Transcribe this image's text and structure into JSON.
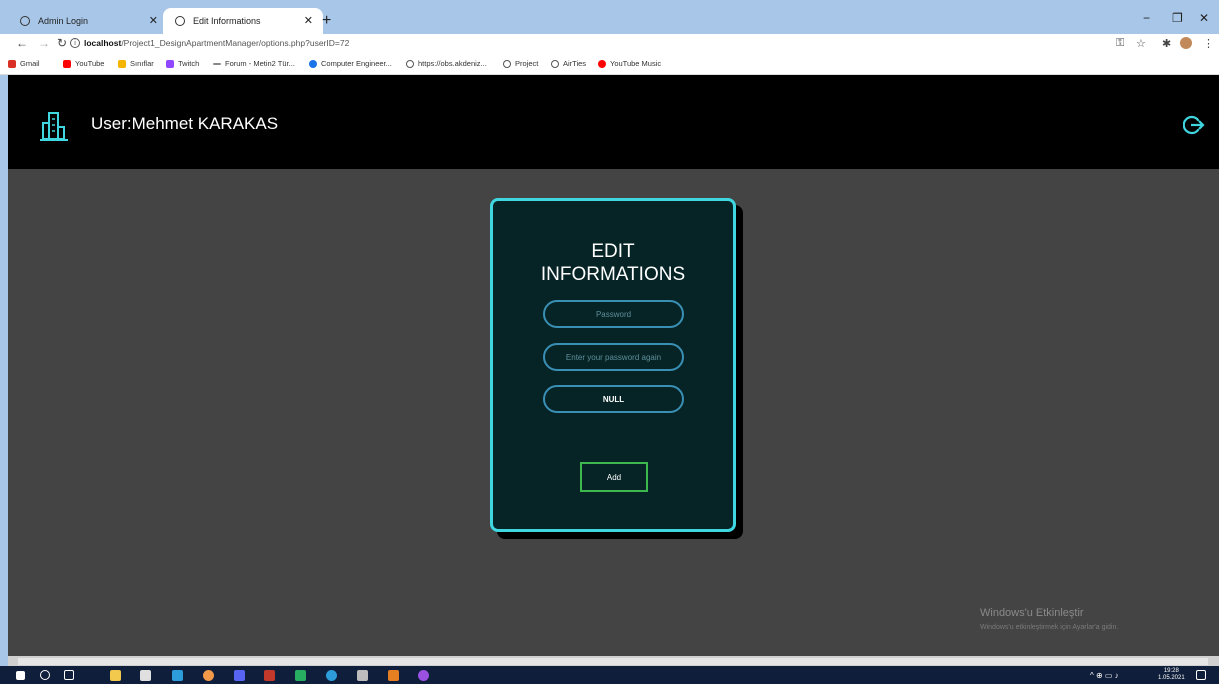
{
  "browser": {
    "tabs": [
      {
        "label": "Admin Login"
      },
      {
        "label": "Edit Informations"
      }
    ],
    "new_tab": "+",
    "url_host": "localhost",
    "url_path": "/Project1_DesignApartmentManager/options.php?userID=72",
    "window_controls": {
      "minimize": "−",
      "restore": "❐",
      "close": "✕"
    },
    "bookmarks": [
      {
        "label": "Gmail",
        "color": "#d93025"
      },
      {
        "label": "YouTube",
        "color": "#ff0000"
      },
      {
        "label": "Sınıflar",
        "color": "#f4b400"
      },
      {
        "label": "Twitch",
        "color": "#9146ff"
      },
      {
        "label": "Forum - Metin2 Tür...",
        "color": "#888888"
      },
      {
        "label": "Computer Engineer...",
        "color": "#1a73e8"
      },
      {
        "label": "https://obs.akdeniz...",
        "color": "#666666"
      },
      {
        "label": "Project",
        "color": "#666666"
      },
      {
        "label": "AirTies",
        "color": "#666666"
      },
      {
        "label": "YouTube Music",
        "color": "#ff0000"
      }
    ]
  },
  "header": {
    "user_label": "User:Mehmet KARAKAS",
    "logo_icon": "building-icon",
    "logout_icon": "logout-icon",
    "accent_color": "#3fd6df"
  },
  "form": {
    "title_line1": "EDIT",
    "title_line2": "INFORMATIONS",
    "password_placeholder": "Password",
    "password_again_placeholder": "Enter your password again",
    "null_value": "NULL",
    "add_label": "Add"
  },
  "watermark": {
    "title": "Windows'u Etkinleştir",
    "subtitle": "Windows'u etkinleştirmek için Ayarlar'a gidin."
  },
  "taskbar": {
    "time": "19:28",
    "date": "1.05.2021"
  }
}
